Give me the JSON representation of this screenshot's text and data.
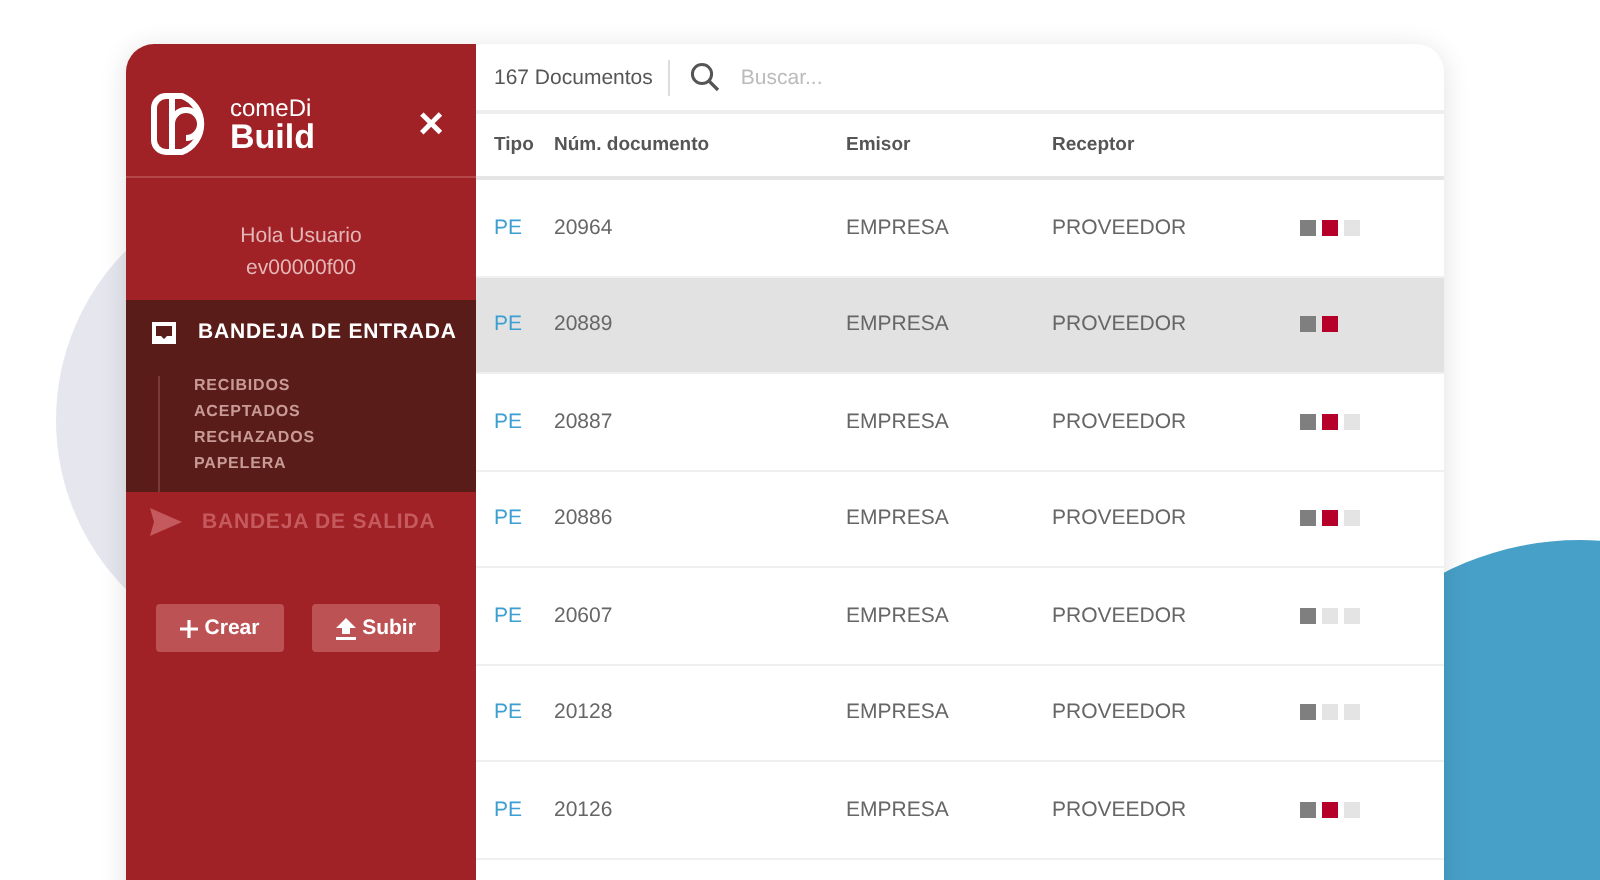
{
  "sidebar": {
    "brand": {
      "line_1": "comeDi",
      "line_2": "Build"
    },
    "close": "×",
    "greeting": "Hola Usuario",
    "user": "ev00000f00",
    "sections": [
      {
        "label": "BANDEJA DE ENTRADA",
        "kind": "inbox",
        "selected": true,
        "children": [
          {
            "label": "RECIBIDOS"
          },
          {
            "label": "ACEPTADOS"
          },
          {
            "label": "RECHAZADOS"
          },
          {
            "label": "PAPELERA"
          }
        ]
      },
      {
        "label": "BANDEJA DE SALIDA",
        "kind": "outbox",
        "selected": false
      }
    ],
    "buttons": [
      {
        "label": "Crear",
        "kind": "create"
      },
      {
        "label": "Subir",
        "kind": "upload"
      }
    ]
  },
  "toolbar": {
    "count": "167 Documentos",
    "search": {
      "placeholder": "Buscar..."
    }
  },
  "table": {
    "columns": [
      "Tipo",
      "Núm. documento",
      "Emisor",
      "Receptor"
    ],
    "rows": [
      {
        "tipo": "PE",
        "numero": "20964",
        "emisor": "EMPRESA",
        "receptor": "PROVEEDOR",
        "selected": false,
        "status": [
          {
            "color": "#7f7f7f"
          },
          {
            "color": "#b5002a"
          },
          {
            "color": "#e4e4e4"
          }
        ]
      },
      {
        "tipo": "PE",
        "numero": "20889",
        "emisor": "EMPRESA",
        "receptor": "PROVEEDOR",
        "selected": true,
        "status": [
          {
            "color": "#7f7f7f"
          },
          {
            "color": "#b5002a"
          }
        ]
      },
      {
        "tipo": "PE",
        "numero": "20887",
        "emisor": "EMPRESA",
        "receptor": "PROVEEDOR",
        "selected": false,
        "status": [
          {
            "color": "#7f7f7f"
          },
          {
            "color": "#b5002a"
          },
          {
            "color": "#e4e4e4"
          }
        ]
      },
      {
        "tipo": "PE",
        "numero": "20886",
        "emisor": "EMPRESA",
        "receptor": "PROVEEDOR",
        "selected": false,
        "status": [
          {
            "color": "#7f7f7f"
          },
          {
            "color": "#b5002a"
          },
          {
            "color": "#e4e4e4"
          }
        ]
      },
      {
        "tipo": "PE",
        "numero": "20607",
        "emisor": "EMPRESA",
        "receptor": "PROVEEDOR",
        "selected": false,
        "status": [
          {
            "color": "#7f7f7f"
          },
          {
            "color": "#e4e4e4"
          },
          {
            "color": "#e4e4e4"
          }
        ]
      },
      {
        "tipo": "PE",
        "numero": "20128",
        "emisor": "EMPRESA",
        "receptor": "PROVEEDOR",
        "selected": false,
        "status": [
          {
            "color": "#7f7f7f"
          },
          {
            "color": "#e4e4e4"
          },
          {
            "color": "#e4e4e4"
          }
        ]
      },
      {
        "tipo": "PE",
        "numero": "20126",
        "emisor": "EMPRESA",
        "receptor": "PROVEEDOR",
        "selected": false,
        "status": [
          {
            "color": "#7f7f7f"
          },
          {
            "color": "#b5002a"
          },
          {
            "color": "#e4e4e4"
          }
        ]
      }
    ]
  }
}
